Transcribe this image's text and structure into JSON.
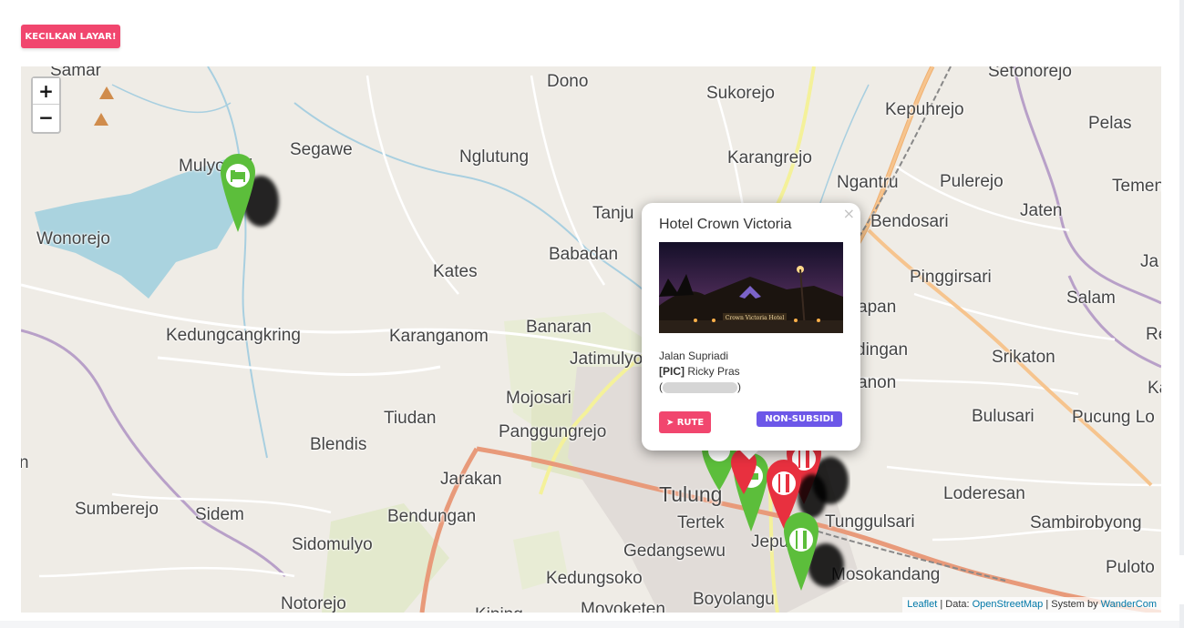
{
  "toolbar": {
    "shrink_label": "KECILKAN LAYAR!"
  },
  "zoom": {
    "in_label": "+",
    "out_label": "−"
  },
  "map": {
    "places": [
      "Samar",
      "Dono",
      "Sukorejo",
      "Setonorejo",
      "Kepuhrejo",
      "Pelas",
      "Segawe",
      "Mulyosari",
      "Nglutung",
      "Karangrejo",
      "Ngantru",
      "Pulerejo",
      "Temen",
      "Wonorejo",
      "Tanju",
      "Bendosari",
      "Jaten",
      "Ja",
      "Babadan",
      "Kates",
      "Pinggirsari",
      "Salam",
      "Kedungcangkring",
      "Karanganom",
      "Banaran",
      "Jatimulyo",
      "Srikaton",
      "Re",
      "Mojosari",
      "Ka",
      "Tiudan",
      "Panggungrejo",
      "Bulusari",
      "Pucung Lo",
      "Blendis",
      "Jarakan",
      "Tulung",
      "Loderesan",
      "Sumberejo",
      "Sidem",
      "Bendungan",
      "Tertek",
      "Tunggulsari",
      "Sambirobyong",
      "Sidomulyo",
      "Gedangsewu",
      "Jepu",
      "Mosokandang",
      "Puloto",
      "Kedungsoko",
      "Notorejo",
      "Boyolangu",
      "Moyoketen",
      "Kiping",
      "n",
      "apan",
      "dingan",
      "anon"
    ]
  },
  "markers": [
    {
      "label": "Hotel Crown Victoria",
      "kind": "hotel",
      "color": "#5cbe3b",
      "icon": "bed-icon"
    },
    {
      "label": "hotel",
      "kind": "hotel",
      "color": "#5cbe3b",
      "icon": "bed-icon"
    },
    {
      "label": "hotel",
      "kind": "hotel",
      "color": "#5cbe3b",
      "icon": "bed-icon"
    },
    {
      "label": "restaurant",
      "kind": "restaurant",
      "color": "#e8303f",
      "icon": "fork-knife-icon"
    },
    {
      "label": "restaurant",
      "kind": "restaurant",
      "color": "#e8303f",
      "icon": "fork-knife-icon"
    },
    {
      "label": "restaurant",
      "kind": "restaurant",
      "color": "#e8303f",
      "icon": "fork-knife-icon"
    },
    {
      "label": "restaurant",
      "kind": "restaurant",
      "color": "#5cbe3b",
      "icon": "fork-knife-icon"
    }
  ],
  "popup": {
    "close": "×",
    "title": "Hotel Crown Victoria",
    "photo_sign": "Crown Victoria Hotel",
    "address": "Jalan Supriadi",
    "pic_label": "[PIC]",
    "pic_name": "Ricky Pras",
    "phone_open": "(",
    "phone_close": ")",
    "route_label": "RUTE",
    "category_badge": "NON-SUBSIDI",
    "badge_color": "#6c57e8"
  },
  "attribution": {
    "leaflet": "Leaflet",
    "sep1": " | Data: ",
    "osm": "OpenStreetMap",
    "sep2": " | System by ",
    "by": "WanderCom"
  }
}
